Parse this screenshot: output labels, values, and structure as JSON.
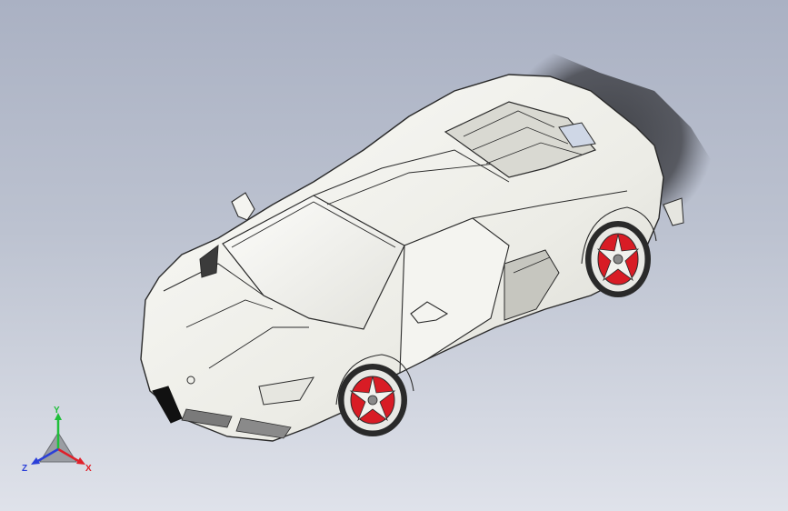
{
  "viewport": {
    "model": "car-assembly",
    "background_top": "#aab1c3",
    "background_bottom": "#dfe2ea",
    "body_color": "#f2f2ee",
    "edge_color": "#2a2a2a",
    "wheel_accent": "#d81c25"
  },
  "triad": {
    "y_label": "Y",
    "x_label": "X",
    "z_label": "Z",
    "y_color": "#1fbf3a",
    "x_color": "#e0202a",
    "z_color": "#2b3fd8"
  }
}
